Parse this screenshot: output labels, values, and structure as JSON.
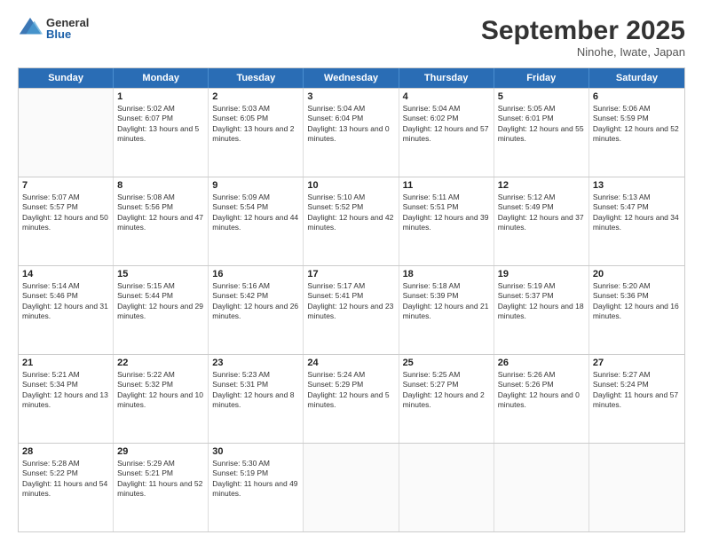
{
  "logo": {
    "general": "General",
    "blue": "Blue"
  },
  "header": {
    "title": "September 2025",
    "location": "Ninohe, Iwate, Japan"
  },
  "days": [
    "Sunday",
    "Monday",
    "Tuesday",
    "Wednesday",
    "Thursday",
    "Friday",
    "Saturday"
  ],
  "weeks": [
    [
      {
        "day": null
      },
      {
        "day": 1,
        "sunrise": "5:02 AM",
        "sunset": "6:07 PM",
        "daylight": "13 hours and 5 minutes."
      },
      {
        "day": 2,
        "sunrise": "5:03 AM",
        "sunset": "6:05 PM",
        "daylight": "13 hours and 2 minutes."
      },
      {
        "day": 3,
        "sunrise": "5:04 AM",
        "sunset": "6:04 PM",
        "daylight": "13 hours and 0 minutes."
      },
      {
        "day": 4,
        "sunrise": "5:04 AM",
        "sunset": "6:02 PM",
        "daylight": "12 hours and 57 minutes."
      },
      {
        "day": 5,
        "sunrise": "5:05 AM",
        "sunset": "6:01 PM",
        "daylight": "12 hours and 55 minutes."
      },
      {
        "day": 6,
        "sunrise": "5:06 AM",
        "sunset": "5:59 PM",
        "daylight": "12 hours and 52 minutes."
      }
    ],
    [
      {
        "day": 7,
        "sunrise": "5:07 AM",
        "sunset": "5:57 PM",
        "daylight": "12 hours and 50 minutes."
      },
      {
        "day": 8,
        "sunrise": "5:08 AM",
        "sunset": "5:56 PM",
        "daylight": "12 hours and 47 minutes."
      },
      {
        "day": 9,
        "sunrise": "5:09 AM",
        "sunset": "5:54 PM",
        "daylight": "12 hours and 44 minutes."
      },
      {
        "day": 10,
        "sunrise": "5:10 AM",
        "sunset": "5:52 PM",
        "daylight": "12 hours and 42 minutes."
      },
      {
        "day": 11,
        "sunrise": "5:11 AM",
        "sunset": "5:51 PM",
        "daylight": "12 hours and 39 minutes."
      },
      {
        "day": 12,
        "sunrise": "5:12 AM",
        "sunset": "5:49 PM",
        "daylight": "12 hours and 37 minutes."
      },
      {
        "day": 13,
        "sunrise": "5:13 AM",
        "sunset": "5:47 PM",
        "daylight": "12 hours and 34 minutes."
      }
    ],
    [
      {
        "day": 14,
        "sunrise": "5:14 AM",
        "sunset": "5:46 PM",
        "daylight": "12 hours and 31 minutes."
      },
      {
        "day": 15,
        "sunrise": "5:15 AM",
        "sunset": "5:44 PM",
        "daylight": "12 hours and 29 minutes."
      },
      {
        "day": 16,
        "sunrise": "5:16 AM",
        "sunset": "5:42 PM",
        "daylight": "12 hours and 26 minutes."
      },
      {
        "day": 17,
        "sunrise": "5:17 AM",
        "sunset": "5:41 PM",
        "daylight": "12 hours and 23 minutes."
      },
      {
        "day": 18,
        "sunrise": "5:18 AM",
        "sunset": "5:39 PM",
        "daylight": "12 hours and 21 minutes."
      },
      {
        "day": 19,
        "sunrise": "5:19 AM",
        "sunset": "5:37 PM",
        "daylight": "12 hours and 18 minutes."
      },
      {
        "day": 20,
        "sunrise": "5:20 AM",
        "sunset": "5:36 PM",
        "daylight": "12 hours and 16 minutes."
      }
    ],
    [
      {
        "day": 21,
        "sunrise": "5:21 AM",
        "sunset": "5:34 PM",
        "daylight": "12 hours and 13 minutes."
      },
      {
        "day": 22,
        "sunrise": "5:22 AM",
        "sunset": "5:32 PM",
        "daylight": "12 hours and 10 minutes."
      },
      {
        "day": 23,
        "sunrise": "5:23 AM",
        "sunset": "5:31 PM",
        "daylight": "12 hours and 8 minutes."
      },
      {
        "day": 24,
        "sunrise": "5:24 AM",
        "sunset": "5:29 PM",
        "daylight": "12 hours and 5 minutes."
      },
      {
        "day": 25,
        "sunrise": "5:25 AM",
        "sunset": "5:27 PM",
        "daylight": "12 hours and 2 minutes."
      },
      {
        "day": 26,
        "sunrise": "5:26 AM",
        "sunset": "5:26 PM",
        "daylight": "12 hours and 0 minutes."
      },
      {
        "day": 27,
        "sunrise": "5:27 AM",
        "sunset": "5:24 PM",
        "daylight": "11 hours and 57 minutes."
      }
    ],
    [
      {
        "day": 28,
        "sunrise": "5:28 AM",
        "sunset": "5:22 PM",
        "daylight": "11 hours and 54 minutes."
      },
      {
        "day": 29,
        "sunrise": "5:29 AM",
        "sunset": "5:21 PM",
        "daylight": "11 hours and 52 minutes."
      },
      {
        "day": 30,
        "sunrise": "5:30 AM",
        "sunset": "5:19 PM",
        "daylight": "11 hours and 49 minutes."
      },
      {
        "day": null
      },
      {
        "day": null
      },
      {
        "day": null
      },
      {
        "day": null
      }
    ]
  ],
  "labels": {
    "sunrise": "Sunrise:",
    "sunset": "Sunset:",
    "daylight": "Daylight:"
  }
}
